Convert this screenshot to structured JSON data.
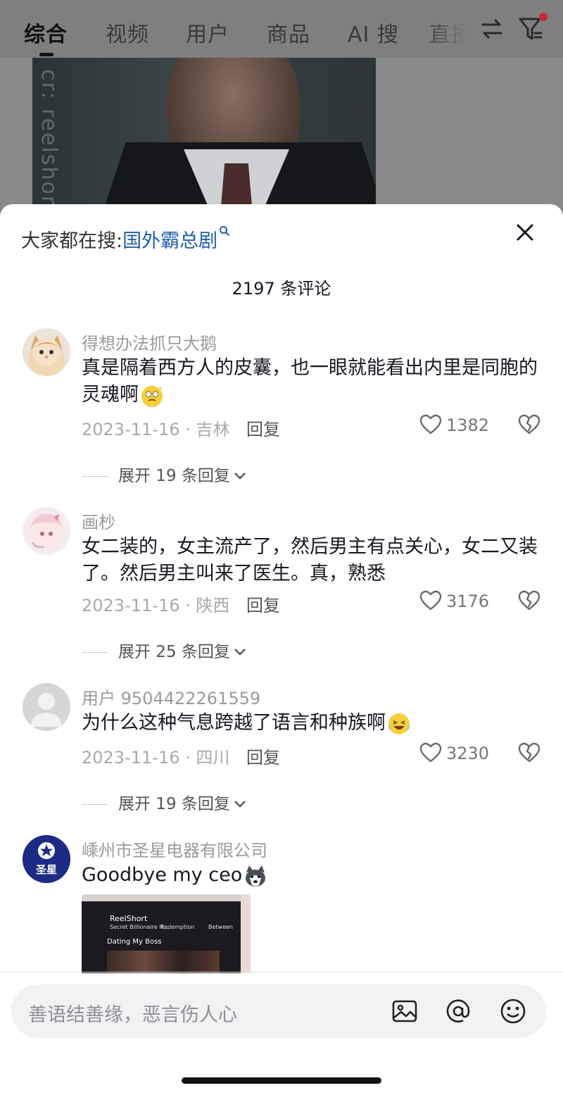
{
  "tabs": [
    {
      "label": "综合",
      "active": true
    },
    {
      "label": "视频"
    },
    {
      "label": "用户"
    },
    {
      "label": "商品"
    },
    {
      "label": "AI 搜"
    },
    {
      "label": "直播"
    }
  ],
  "icons": {
    "swap": "swap-icon",
    "filter": "filter-icon",
    "close": "close-icon"
  },
  "video": {
    "watermark": "cr: reelshort"
  },
  "sheet": {
    "hot_search_prefix": "大家都在搜:",
    "hot_search_query": "国外霸总剧",
    "comment_count_title": "2197 条评论"
  },
  "comments": [
    {
      "username": "得想办法抓只大鹅",
      "text": "真是隔着西方人的皮囊，也一眼就能看出内里是同胞的灵魂啊",
      "date_location": "2023-11-16 · 吉林",
      "reply": "回复",
      "likes": "1382",
      "expand": "展开 19 条回复"
    },
    {
      "username": "画杪",
      "text": "女二装的，女主流产了，然后男主有点关心，女二又装了。然后男主叫来了医生。真，熟悉",
      "date_location": "2023-11-16 · 陕西",
      "reply": "回复",
      "likes": "3176",
      "expand": "展开 25 条回复"
    },
    {
      "username": "用户 9504422261559",
      "text": "为什么这种气息跨越了语言和种族啊",
      "date_location": "2023-11-16 · 四川",
      "reply": "回复",
      "likes": "3230",
      "expand": "展开 19 条回复"
    },
    {
      "username": "嵊州市圣星电器有限公司",
      "text": "Goodbye my ceo",
      "avatar_text": "圣星"
    }
  ],
  "thumbnail": {
    "brand": "ReelShort",
    "title": "Dating My Boss",
    "item1": "Secret Billionaire H...",
    "item2": "Redemption",
    "item3": "Between"
  },
  "input": {
    "placeholder": "善语结善缘，恶言伤人心"
  },
  "colors": {
    "link": "#1f5fa8",
    "notification_dot": "#c8283a"
  }
}
